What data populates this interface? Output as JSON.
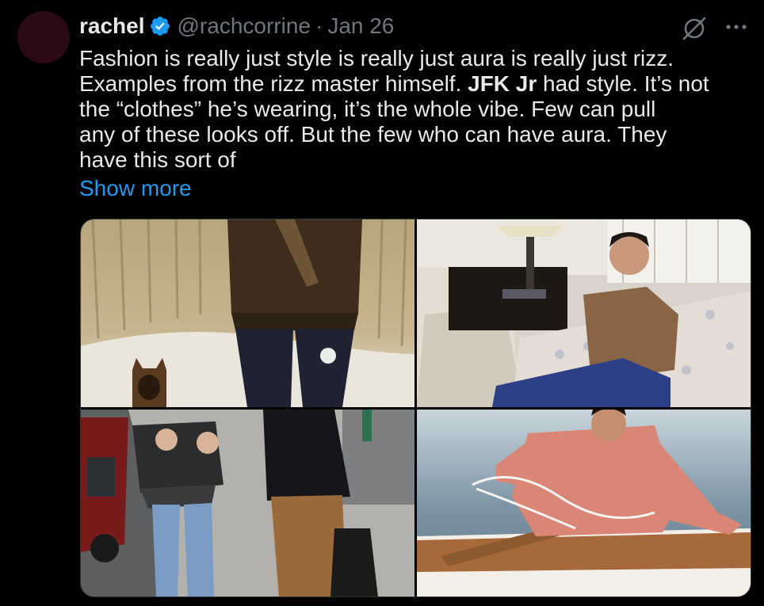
{
  "tweet": {
    "author": {
      "display_name": "rachel",
      "handle": "@rachcorrine",
      "verified": true
    },
    "separator": "·",
    "date": "Jan 26",
    "text_before_mention": "Fashion is really just style is really just aura is really just rizz.\nExamples from the rizz master himself. ",
    "mention": "JFK Jr",
    "text_after_mention": " had style. It’s not\nthe “clothes” he’s wearing, it’s the whole vibe. Few can pull\nany of these looks off. But the few who can have aura. They\nhave this sort of",
    "show_more_label": "Show more",
    "icons": {
      "verified": "verified-badge-icon",
      "grok": "grok-icon",
      "more": "more-options-icon"
    },
    "media": [
      {
        "name": "photo-walking-dog",
        "scene": "man in dark sweater walking with dog on beach path"
      },
      {
        "name": "photo-sofa",
        "scene": "man in suede jacket lounging on sofa"
      },
      {
        "name": "photo-street",
        "scene": "couple walking on city sidewalk"
      },
      {
        "name": "photo-boat",
        "scene": "man in salmon shirt on wooden boat"
      }
    ]
  },
  "colors": {
    "background": "#000000",
    "text_primary": "#e7e9ea",
    "text_secondary": "#71767b",
    "link": "#1d9bf0",
    "verified": "#1d9bf0",
    "avatar": "#2a0a14"
  }
}
